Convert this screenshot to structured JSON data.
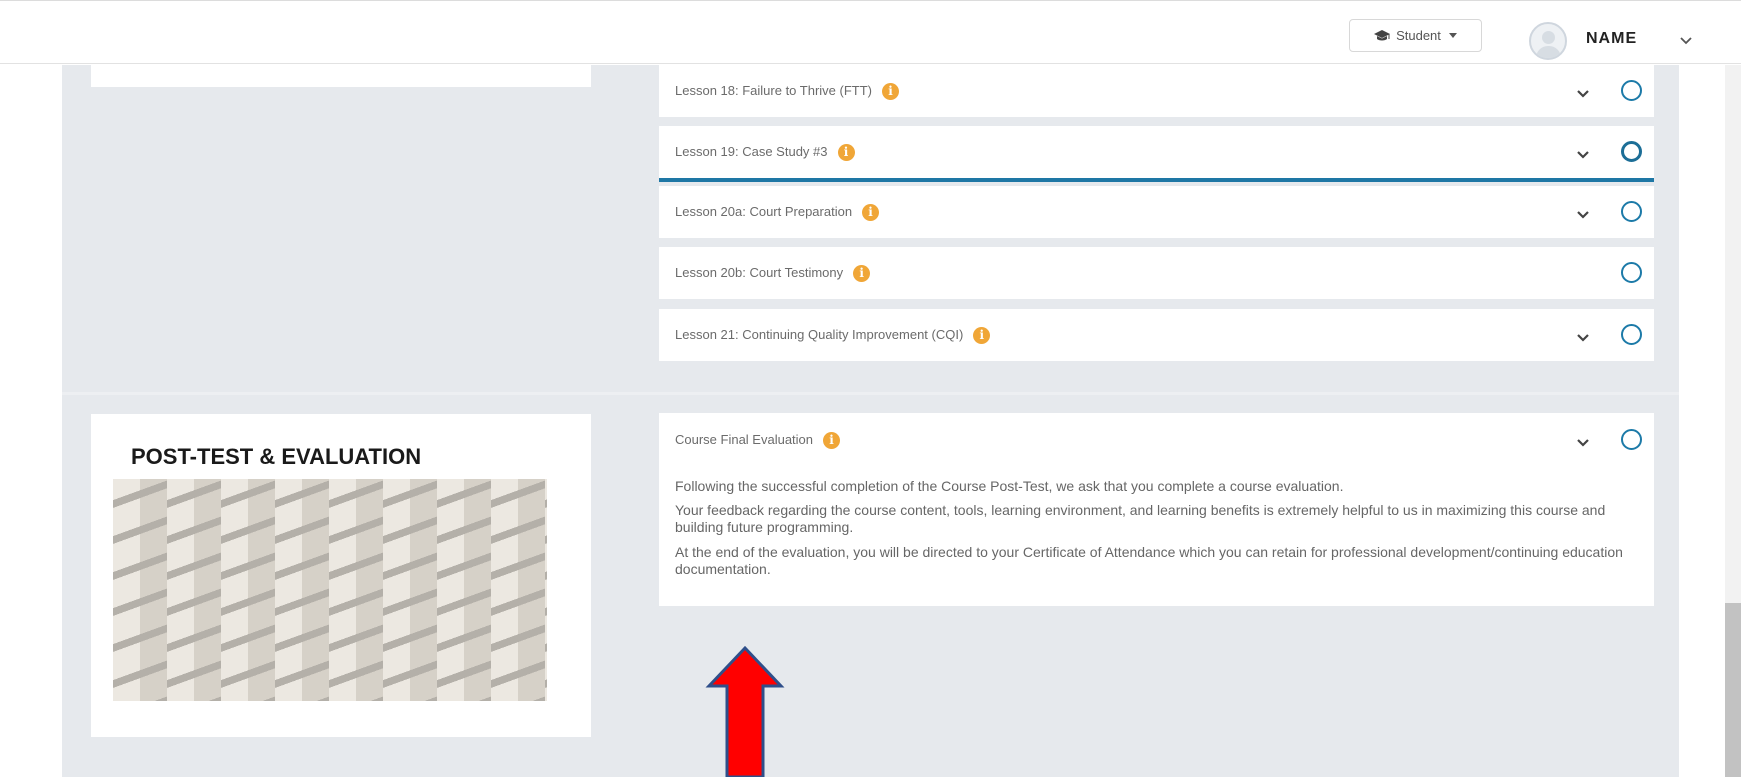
{
  "header": {
    "role_label": "Student",
    "user_name": "NAME"
  },
  "module": {
    "title": "POST-TEST & EVALUATION"
  },
  "lessons": [
    {
      "label": "Lesson 18: Failure to Thrive (FTT)",
      "has_chevron": true
    },
    {
      "label": "Lesson 19: Case Study #3",
      "has_chevron": true,
      "active": true
    },
    {
      "label": "Lesson 20a: Court Preparation",
      "has_chevron": true
    },
    {
      "label": "Lesson 20b: Court Testimony",
      "has_chevron": false
    },
    {
      "label": "Lesson 21: Continuing Quality Improvement (CQI)",
      "has_chevron": true
    }
  ],
  "final_evaluation": {
    "label": "Course Final Evaluation",
    "paragraphs": [
      "Following the successful completion of the Course Post-Test, we ask that you complete a course evaluation.",
      "Your feedback regarding the course content, tools, learning environment, and learning benefits is extremely helpful to us in maximizing this course and building future programming.",
      "At the end of the evaluation, you will be directed to your Certificate of Attendance which you can retain for professional development/continuing education documentation."
    ]
  },
  "icons": {
    "info": "info-icon",
    "expand": "chevron-down-icon",
    "status": "circle-status-icon",
    "role": "graduation-cap-icon",
    "annotation": "red-arrow-icon"
  },
  "colors": {
    "accent_blue": "#1e77a5",
    "info_orange": "#f0a637",
    "annotation_red": "#ff0000",
    "content_bg": "#e6e9ed"
  }
}
